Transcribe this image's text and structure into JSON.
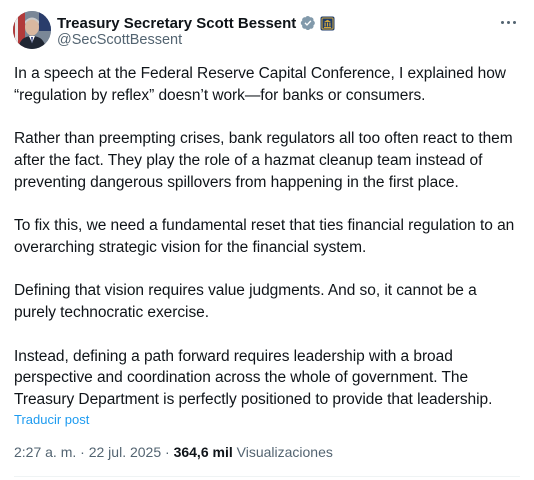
{
  "author": {
    "name": "Treasury Secretary Scott Bessent",
    "handle": "@SecScottBessent",
    "verified_icon": "verified-check-icon",
    "affiliation_icon": "treasury-seal-icon"
  },
  "post": {
    "paragraphs": [
      "In a speech at the Federal Reserve Capital Conference, I explained how “regulation by reflex” doesn’t work—for banks or consumers.",
      "Rather than preempting crises, bank regulators all too often react to them after the fact. They play the role of a hazmat cleanup team instead of preventing dangerous spillovers from happening in the first place.",
      "To fix this, we need a fundamental reset that ties financial regulation to an overarching strategic vision for the financial system.",
      "Defining that vision requires value judgments. And so, it cannot be a purely technocratic exercise.",
      "Instead, defining a path forward requires leadership with a broad perspective and coordination across the whole of government. The Treasury Department is perfectly positioned to provide that leadership."
    ],
    "translate_label": "Traducir post"
  },
  "meta": {
    "time": "2:27 a. m.",
    "separator": " · ",
    "date": "22 jul. 2025",
    "views_count": "364,6 mil",
    "views_label": "Visualizaciones"
  },
  "colors": {
    "text": "#0f1419",
    "secondary": "#536471",
    "link": "#1d9bf0",
    "verified": "#829aab"
  }
}
